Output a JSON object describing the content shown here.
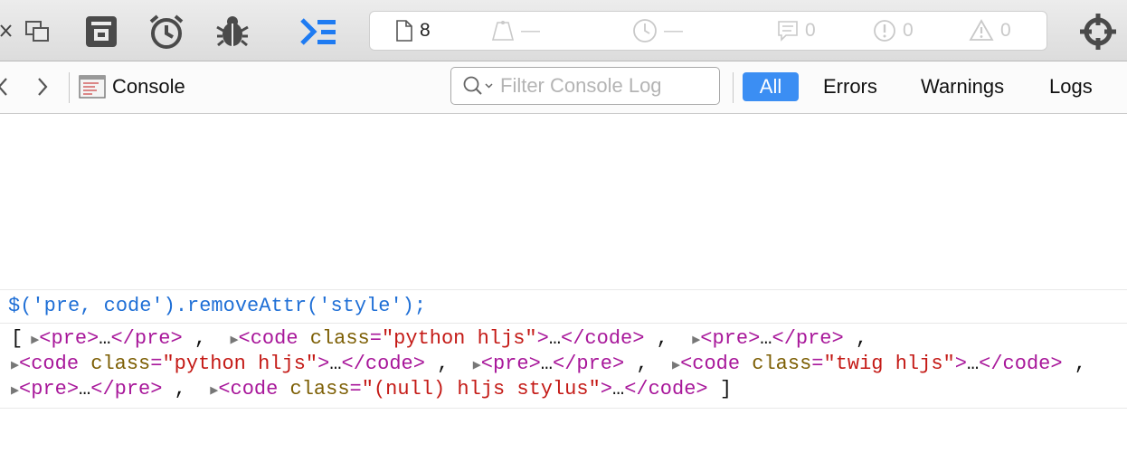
{
  "toolbar": {
    "resource_count": "8",
    "size_value": "—",
    "time_value": "—",
    "log_count": "0",
    "error_count": "0",
    "warning_count": "0",
    "icons": [
      "close-icon",
      "dock-icon",
      "storage-icon",
      "timer-icon",
      "bug-icon",
      "console-tab-icon",
      "document-icon",
      "weight-icon",
      "clock-icon",
      "log-icon",
      "error-icon",
      "warning-icon",
      "target-icon"
    ],
    "accent": "#1e7bf2"
  },
  "navbar": {
    "title": "Console",
    "filter_placeholder": "Filter Console Log",
    "segments": [
      "All",
      "Errors",
      "Warnings",
      "Logs"
    ],
    "active_segment": "All",
    "active_color": "#3b8ef3"
  },
  "console": {
    "prompt": "$('pre, code').removeAttr('style');",
    "result": {
      "open_bracket": "[",
      "close_bracket": "]",
      "items": [
        {
          "tag_open": "<pre>",
          "ellipsis": "…",
          "tag_close": "</pre>"
        },
        {
          "tag_name": "<code",
          "attr": "class",
          "eq": "=",
          "value": "\"python hljs\"",
          "gt": ">",
          "ellipsis": "…",
          "tag_close": "</code>"
        },
        {
          "tag_open": "<pre>",
          "ellipsis": "…",
          "tag_close": "</pre>"
        },
        {
          "tag_name": "<code",
          "attr": "class",
          "eq": "=",
          "value": "\"python hljs\"",
          "gt": ">",
          "ellipsis": "…",
          "tag_close": "</code>"
        },
        {
          "tag_open": "<pre>",
          "ellipsis": "…",
          "tag_close": "</pre>"
        },
        {
          "tag_name": "<code",
          "attr": "class",
          "eq": "=",
          "value": "\"twig hljs\"",
          "gt": ">",
          "ellipsis": "…",
          "tag_close": "</code>"
        },
        {
          "tag_open": "<pre>",
          "ellipsis": "…",
          "tag_close": "</pre>"
        },
        {
          "tag_name": "<code",
          "attr": "class",
          "eq": "=",
          "value": "\"(null) hljs stylus\"",
          "gt": ">",
          "ellipsis": "…",
          "tag_close": "</code>"
        }
      ],
      "separator": ","
    }
  }
}
